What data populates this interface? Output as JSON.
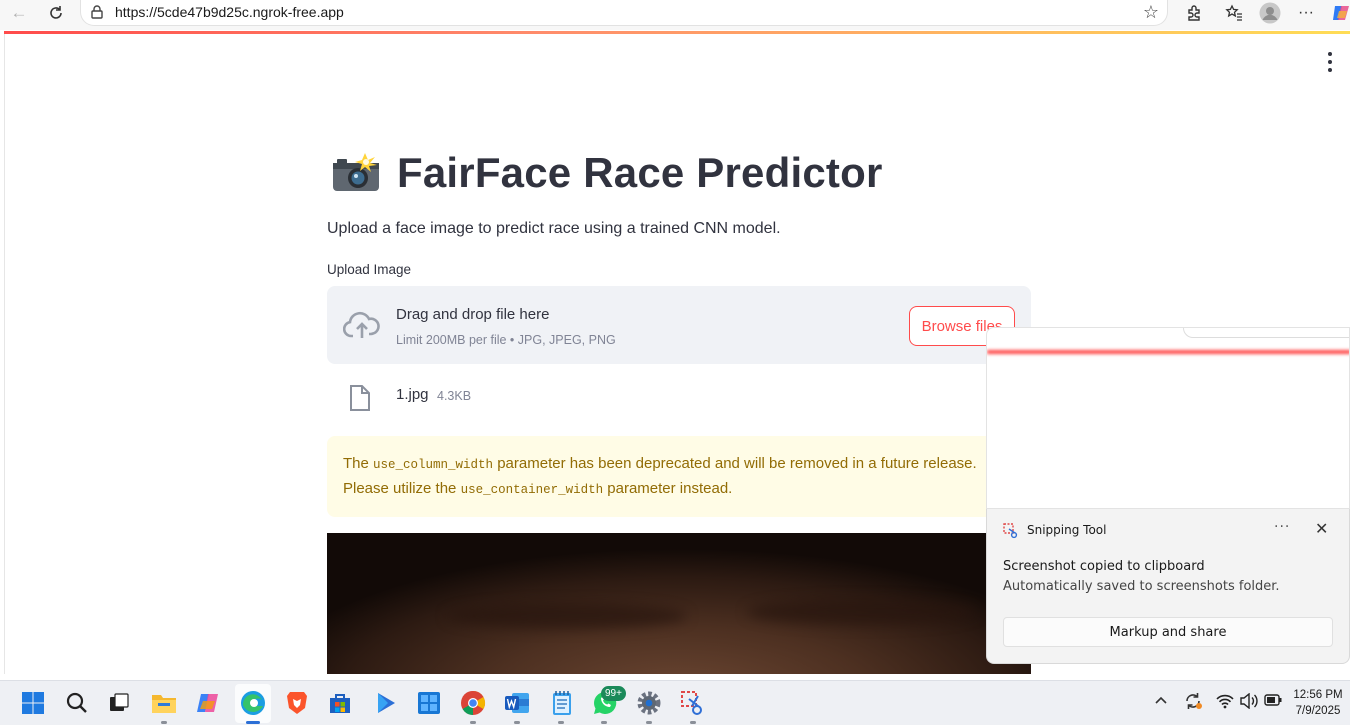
{
  "browser": {
    "url": "https://5cde47b9d25c.ngrok-free.app"
  },
  "app": {
    "title": "FairFace Race Predictor",
    "subtitle": "Upload a face image to predict race using a trained CNN model.",
    "upload_label": "Upload Image",
    "dropzone": {
      "main_text": "Drag and drop file here",
      "limit_text": "Limit 200MB per file • JPG, JPEG, PNG",
      "browse_label": "Browse files"
    },
    "file": {
      "name": "1.jpg",
      "size": "4.3KB"
    },
    "warning": {
      "part1": "The ",
      "code1": "use_column_width",
      "part2": " parameter has been deprecated and will be removed in a future release. Please utilize the ",
      "code2": "use_container_width",
      "part3": " parameter instead."
    }
  },
  "toast": {
    "app_name": "Snipping Tool",
    "more": "···",
    "close": "✕",
    "title": "Screenshot copied to clipboard",
    "body": "Automatically saved to screenshots folder.",
    "button": "Markup and share"
  },
  "taskbar": {
    "badge": "99+",
    "time": "12:56 PM",
    "date": "7/9/2025"
  },
  "colors": {
    "accent": "#ff4b4b",
    "warning_bg": "#fffce6",
    "warning_text": "#926c05",
    "dropzone_bg": "#f0f2f6"
  }
}
